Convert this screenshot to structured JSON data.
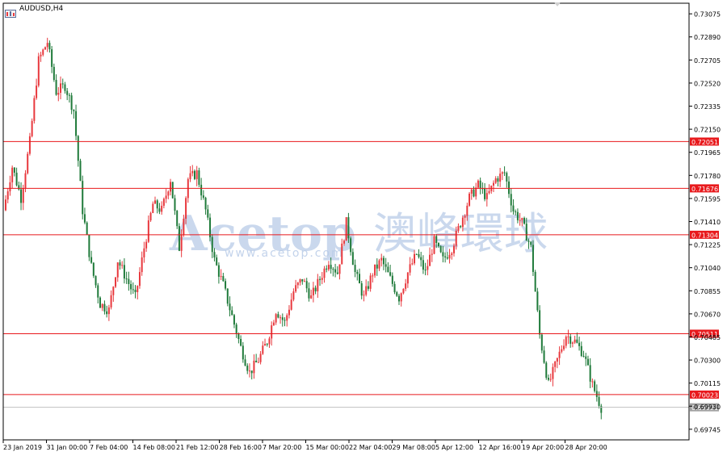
{
  "window": {
    "symbol_title": "AUDUSD,H4"
  },
  "watermark": {
    "brand": "Acetop",
    "chinese": "澳峰環球",
    "url": "www.acetop.com"
  },
  "colors": {
    "bull": "#e8383d",
    "bear": "#1f7a3a",
    "level_line": "#e8191c",
    "level_label_bg": "#e8191c",
    "current_price_line": "#c0c0c0",
    "current_price_label_bg": "#a0a0a0",
    "watermark": "#b9cce8"
  },
  "chart_data": {
    "type": "candlestick",
    "instrument": "AUDUSD",
    "timeframe": "H4",
    "x_tick_labels": [
      "23 Jan 2019",
      "31 Jan 00:00",
      "7 Feb 04:00",
      "14 Feb 08:00",
      "21 Feb 12:00",
      "28 Feb 16:00",
      "7 Mar 20:00",
      "15 Mar 00:00",
      "22 Mar 04:00",
      "29 Mar 08:00",
      "5 Apr 12:00",
      "12 Apr 16:00",
      "19 Apr 20:00",
      "28 Apr 20:00"
    ],
    "y_tick_labels": [
      "0.73075",
      "0.72890",
      "0.72705",
      "0.72520",
      "0.72335",
      "0.72150",
      "0.71965",
      "0.71780",
      "0.71595",
      "0.71410",
      "0.71225",
      "0.71040",
      "0.70855",
      "0.70670",
      "0.70485",
      "0.70300",
      "0.70115",
      "0.69930",
      "0.69745"
    ],
    "ylim": [
      0.6966,
      0.7316
    ],
    "horizontal_levels": [
      "0.72051",
      "0.71676",
      "0.71304",
      "0.70511",
      "0.70023"
    ],
    "current_price": "0.69921",
    "series": [
      {
        "x": "23 Jan 2019",
        "close": 0.715
      },
      {
        "x": "25 Jan",
        "close": 0.7185
      },
      {
        "x": "28 Jan",
        "close": 0.716
      },
      {
        "x": "29 Jan",
        "close": 0.7205
      },
      {
        "x": "30 Jan",
        "close": 0.727
      },
      {
        "x": "31 Jan 00:00",
        "close": 0.7285
      },
      {
        "x": "1 Feb",
        "close": 0.7245
      },
      {
        "x": "4 Feb",
        "close": 0.725
      },
      {
        "x": "5 Feb",
        "close": 0.723
      },
      {
        "x": "6 Feb",
        "close": 0.715
      },
      {
        "x": "7 Feb 04:00",
        "close": 0.7105
      },
      {
        "x": "8 Feb",
        "close": 0.7075
      },
      {
        "x": "11 Feb",
        "close": 0.707
      },
      {
        "x": "12 Feb",
        "close": 0.711
      },
      {
        "x": "13 Feb",
        "close": 0.7095
      },
      {
        "x": "14 Feb 08:00",
        "close": 0.708
      },
      {
        "x": "15 Feb",
        "close": 0.712
      },
      {
        "x": "18 Feb",
        "close": 0.7155
      },
      {
        "x": "19 Feb",
        "close": 0.715
      },
      {
        "x": "20 Feb",
        "close": 0.7175
      },
      {
        "x": "21 Feb 12:00",
        "close": 0.712
      },
      {
        "x": "22 Feb",
        "close": 0.7175
      },
      {
        "x": "25 Feb",
        "close": 0.718
      },
      {
        "x": "26 Feb",
        "close": 0.715
      },
      {
        "x": "27 Feb",
        "close": 0.711
      },
      {
        "x": "28 Feb 16:00",
        "close": 0.709
      },
      {
        "x": "1 Mar",
        "close": 0.7065
      },
      {
        "x": "4 Mar",
        "close": 0.704
      },
      {
        "x": "5 Mar",
        "close": 0.702
      },
      {
        "x": "6 Mar",
        "close": 0.703
      },
      {
        "x": "7 Mar 20:00",
        "close": 0.7045
      },
      {
        "x": "8 Mar",
        "close": 0.707
      },
      {
        "x": "11 Mar",
        "close": 0.706
      },
      {
        "x": "12 Mar",
        "close": 0.7085
      },
      {
        "x": "13 Mar",
        "close": 0.7095
      },
      {
        "x": "14 Mar",
        "close": 0.708
      },
      {
        "x": "15 Mar 00:00",
        "close": 0.7095
      },
      {
        "x": "18 Mar",
        "close": 0.711
      },
      {
        "x": "19 Mar",
        "close": 0.71
      },
      {
        "x": "20 Mar",
        "close": 0.714
      },
      {
        "x": "21 Mar",
        "close": 0.71
      },
      {
        "x": "22 Mar 04:00",
        "close": 0.708
      },
      {
        "x": "25 Mar",
        "close": 0.71
      },
      {
        "x": "26 Mar",
        "close": 0.711
      },
      {
        "x": "27 Mar",
        "close": 0.7095
      },
      {
        "x": "28 Mar",
        "close": 0.708
      },
      {
        "x": "29 Mar 08:00",
        "close": 0.71
      },
      {
        "x": "1 Apr",
        "close": 0.7115
      },
      {
        "x": "2 Apr",
        "close": 0.71
      },
      {
        "x": "3 Apr",
        "close": 0.7125
      },
      {
        "x": "4 Apr",
        "close": 0.711
      },
      {
        "x": "5 Apr 12:00",
        "close": 0.712
      },
      {
        "x": "8 Apr",
        "close": 0.714
      },
      {
        "x": "9 Apr",
        "close": 0.716
      },
      {
        "x": "10 Apr",
        "close": 0.717
      },
      {
        "x": "11 Apr",
        "close": 0.716
      },
      {
        "x": "12 Apr 16:00",
        "close": 0.7175
      },
      {
        "x": "15 Apr",
        "close": 0.718
      },
      {
        "x": "16 Apr",
        "close": 0.715
      },
      {
        "x": "17 Apr",
        "close": 0.714
      },
      {
        "x": "18 Apr",
        "close": 0.712
      },
      {
        "x": "19 Apr 20:00",
        "close": 0.705
      },
      {
        "x": "22 Apr",
        "close": 0.701
      },
      {
        "x": "23 Apr",
        "close": 0.703
      },
      {
        "x": "24 Apr",
        "close": 0.705
      },
      {
        "x": "25 Apr",
        "close": 0.7045
      },
      {
        "x": "28 Apr 20:00",
        "close": 0.7035
      },
      {
        "x": "29 Apr",
        "close": 0.701
      },
      {
        "x": "30 Apr",
        "close": 0.6992
      }
    ]
  }
}
